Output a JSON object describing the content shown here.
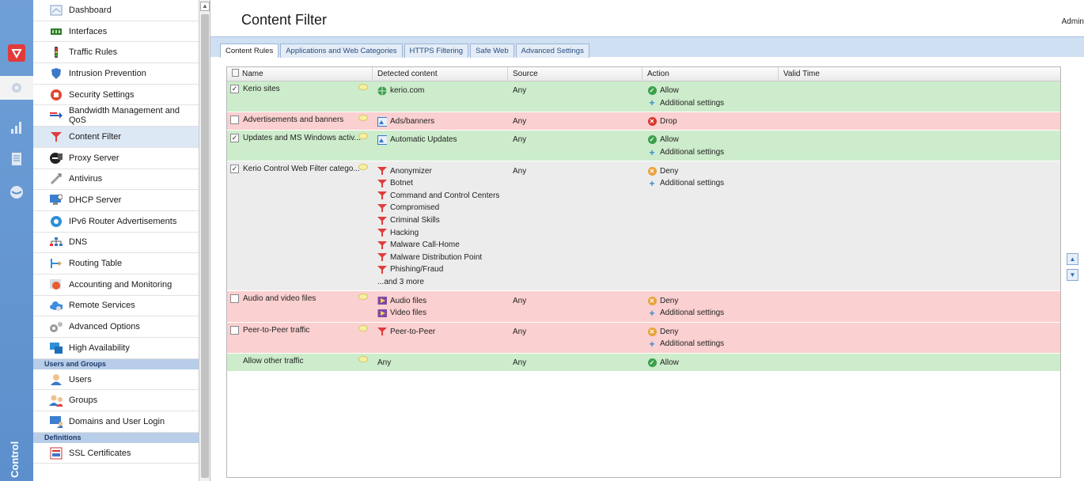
{
  "window": {
    "title": "Content Filter",
    "user": "Admin"
  },
  "rail": {
    "label": "Control"
  },
  "sidebar": {
    "items": [
      {
        "label": "Dashboard",
        "icon": "dashboard-icon"
      },
      {
        "label": "Interfaces",
        "icon": "interfaces-icon"
      },
      {
        "label": "Traffic Rules",
        "icon": "traffic-rules-icon"
      },
      {
        "label": "Intrusion Prevention",
        "icon": "shield-icon"
      },
      {
        "label": "Security Settings",
        "icon": "security-icon"
      },
      {
        "label": "Bandwidth Management and QoS",
        "icon": "bandwidth-icon"
      },
      {
        "label": "Content Filter",
        "icon": "funnel-icon",
        "active": true
      },
      {
        "label": "Proxy Server",
        "icon": "proxy-icon"
      },
      {
        "label": "Antivirus",
        "icon": "antivirus-icon"
      },
      {
        "label": "DHCP Server",
        "icon": "dhcp-icon"
      },
      {
        "label": "IPv6 Router Advertisements",
        "icon": "ipv6-icon"
      },
      {
        "label": "DNS",
        "icon": "dns-icon"
      },
      {
        "label": "Routing Table",
        "icon": "routing-icon"
      },
      {
        "label": "Accounting and Monitoring",
        "icon": "accounting-icon"
      },
      {
        "label": "Remote Services",
        "icon": "cloud-icon"
      },
      {
        "label": "Advanced Options",
        "icon": "gears-icon"
      },
      {
        "label": "High Availability",
        "icon": "high-availability-icon"
      }
    ],
    "section_users": "Users and Groups",
    "users_items": [
      {
        "label": "Users",
        "icon": "user-icon"
      },
      {
        "label": "Groups",
        "icon": "group-icon"
      },
      {
        "label": "Domains and User Login",
        "icon": "domain-icon"
      }
    ],
    "section_definitions": "Definitions",
    "definitions_items": [
      {
        "label": "SSL Certificates",
        "icon": "certificate-icon"
      }
    ]
  },
  "tabs": [
    {
      "label": "Content Rules",
      "active": true
    },
    {
      "label": "Applications and Web Categories"
    },
    {
      "label": "HTTPS Filtering"
    },
    {
      "label": "Safe Web"
    },
    {
      "label": "Advanced Settings"
    }
  ],
  "grid": {
    "columns": {
      "name": "Name",
      "detected": "Detected content",
      "source": "Source",
      "action": "Action",
      "valid": "Valid Time"
    },
    "rows": [
      {
        "checked": true,
        "color": "green",
        "name": "Kerio sites",
        "detected": [
          {
            "icon": "globe",
            "text": "kerio.com"
          }
        ],
        "source": "Any",
        "action": [
          {
            "icon": "allow",
            "text": "Allow"
          },
          {
            "icon": "plus",
            "text": "Additional settings"
          }
        ]
      },
      {
        "checked": false,
        "color": "red",
        "name": "Advertisements and banners",
        "detected": [
          {
            "icon": "ads",
            "text": "Ads/banners"
          }
        ],
        "source": "Any",
        "action": [
          {
            "icon": "drop",
            "text": "Drop"
          }
        ]
      },
      {
        "checked": true,
        "color": "green",
        "name": "Updates and MS Windows activ...",
        "detected": [
          {
            "icon": "ads",
            "text": "Automatic Updates"
          }
        ],
        "source": "Any",
        "action": [
          {
            "icon": "allow",
            "text": "Allow"
          },
          {
            "icon": "plus",
            "text": "Additional settings"
          }
        ]
      },
      {
        "checked": true,
        "color": "gray",
        "name": "Kerio Control Web Filter catego...",
        "detected": [
          {
            "icon": "funnel",
            "text": "Anonymizer"
          },
          {
            "icon": "funnel",
            "text": "Botnet"
          },
          {
            "icon": "funnel",
            "text": "Command and Control Centers"
          },
          {
            "icon": "funnel",
            "text": "Compromised"
          },
          {
            "icon": "funnel",
            "text": "Criminal Skills"
          },
          {
            "icon": "funnel",
            "text": "Hacking"
          },
          {
            "icon": "funnel",
            "text": "Malware Call-Home"
          },
          {
            "icon": "funnel",
            "text": "Malware Distribution Point"
          },
          {
            "icon": "funnel",
            "text": "Phishing/Fraud"
          },
          {
            "icon": "none",
            "text": "...and 3 more"
          }
        ],
        "source": "Any",
        "action": [
          {
            "icon": "deny",
            "text": "Deny"
          },
          {
            "icon": "plus",
            "text": "Additional settings"
          }
        ]
      },
      {
        "checked": false,
        "color": "red",
        "name": "Audio and video files",
        "detected": [
          {
            "icon": "media",
            "text": "Audio files"
          },
          {
            "icon": "media",
            "text": "Video files"
          }
        ],
        "source": "Any",
        "action": [
          {
            "icon": "deny",
            "text": "Deny"
          },
          {
            "icon": "plus",
            "text": "Additional settings"
          }
        ]
      },
      {
        "checked": false,
        "color": "red",
        "name": "Peer-to-Peer traffic",
        "detected": [
          {
            "icon": "funnel",
            "text": "Peer-to-Peer"
          }
        ],
        "source": "Any",
        "action": [
          {
            "icon": "deny",
            "text": "Deny"
          },
          {
            "icon": "plus",
            "text": "Additional settings"
          }
        ]
      },
      {
        "checked": null,
        "color": "green",
        "name": "Allow other traffic",
        "detected": [
          {
            "icon": "none",
            "text": "Any"
          }
        ],
        "source": "Any",
        "action": [
          {
            "icon": "allow",
            "text": "Allow"
          }
        ]
      }
    ]
  },
  "colors": {
    "rule_allow_bg": "#cdeccb",
    "rule_deny_bg": "#fbd0d0",
    "rule_neutral_bg": "#ececec",
    "accent": "#5c8fcc"
  }
}
